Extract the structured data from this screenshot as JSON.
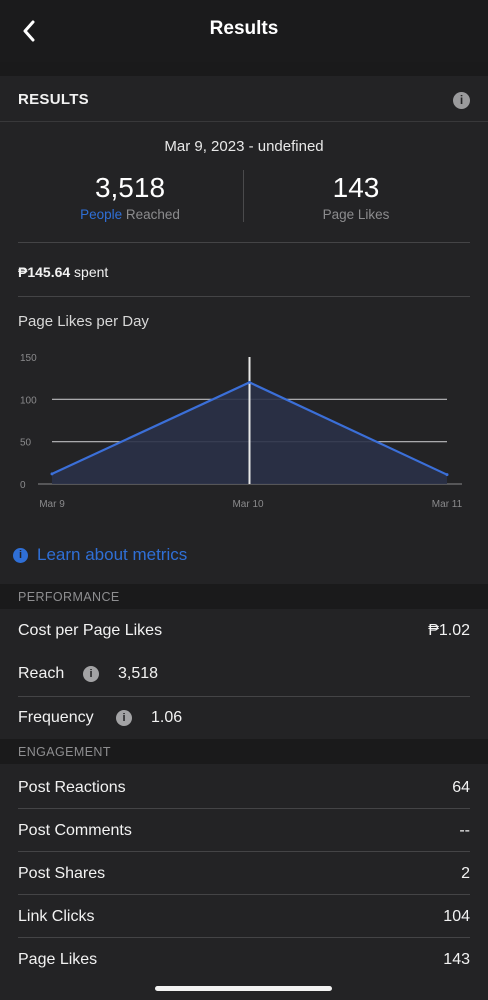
{
  "header": {
    "title": "Results",
    "back_icon": "chevron-left-icon"
  },
  "results_section": {
    "label": "RESULTS",
    "info_icon": "info-icon"
  },
  "summary": {
    "date_range": "Mar 9, 2023 - undefined",
    "people_reached": {
      "value": "3,518",
      "label_highlight": "People",
      "label_rest": " Reached"
    },
    "page_likes": {
      "value": "143",
      "label": "Page Likes"
    },
    "spent": {
      "amount": "₱145.64",
      "suffix": " spent"
    }
  },
  "chart_data": {
    "type": "area",
    "title": "Page Likes per Day",
    "categories": [
      "Mar 9",
      "Mar 10",
      "Mar 11"
    ],
    "x_tick_labels": [
      "Mar 9",
      "Mar 10",
      "Mar 11"
    ],
    "y_tick_labels": [
      "0",
      "50",
      "100",
      "150"
    ],
    "series": [
      {
        "values": [
          12,
          120,
          11
        ]
      }
    ],
    "ylim": [
      0,
      150
    ],
    "grid": true,
    "line_color": "#3b6fd8",
    "fill_color": "#2a3148"
  },
  "learn_link": {
    "label": "Learn about metrics"
  },
  "performance": {
    "heading": "PERFORMANCE",
    "cost_label": "Cost per Page Likes",
    "cost_value": "₱1.02",
    "reach_label": "Reach",
    "reach_value": "3,518",
    "frequency_label": "Frequency",
    "frequency_value": "1.06"
  },
  "engagement": {
    "heading": "ENGAGEMENT",
    "rows": [
      {
        "label": "Post Reactions",
        "value": "64"
      },
      {
        "label": "Post Comments",
        "value": "--"
      },
      {
        "label": "Post Shares",
        "value": "2"
      },
      {
        "label": "Link Clicks",
        "value": "104"
      },
      {
        "label": "Page Likes",
        "value": "143"
      }
    ]
  },
  "colors": {
    "accent": "#2f6fd6",
    "background": "#1a1a1b",
    "card": "#232325"
  }
}
